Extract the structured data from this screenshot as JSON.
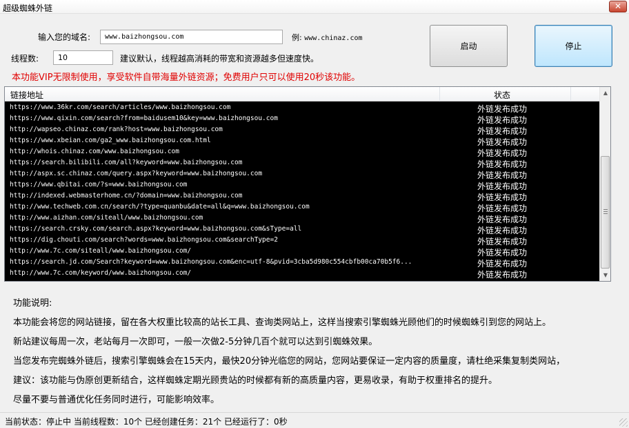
{
  "window": {
    "title": "超级蜘蛛外链",
    "close_label": "✕"
  },
  "form": {
    "domain_label": "输入您的域名:",
    "domain_value": "www.baizhongsou.com",
    "example_prefix": "例:",
    "example_value": "www.chinaz.com",
    "threads_label": "线程数:",
    "threads_value": "10",
    "threads_hint": "建议默认，线程越高消耗的带宽和资源越多但速度快。"
  },
  "buttons": {
    "start": "启动",
    "stop": "停止"
  },
  "vip_notice": "本功能VIP无限制使用，享受软件自带海量外链资源；免费用户只可以使用20秒该功能。",
  "table": {
    "columns": [
      "链接地址",
      "状态"
    ],
    "rows": [
      {
        "url": "https://www.36kr.com/search/articles/www.baizhongsou.com",
        "status": "外链发布成功"
      },
      {
        "url": "https://www.qixin.com/search?from=baidusem10&key=www.baizhongsou.com",
        "status": "外链发布成功"
      },
      {
        "url": "http://wapseo.chinaz.com/rank?host=www.baizhongsou.com",
        "status": "外链发布成功"
      },
      {
        "url": "https://www.xbeian.com/ga2_www.baizhongsou.com.html",
        "status": "外链发布成功"
      },
      {
        "url": "http://whois.chinaz.com/www.baizhongsou.com",
        "status": "外链发布成功"
      },
      {
        "url": "https://search.bilibili.com/all?keyword=www.baizhongsou.com",
        "status": "外链发布成功"
      },
      {
        "url": "http://aspx.sc.chinaz.com/query.aspx?keyword=www.baizhongsou.com",
        "status": "外链发布成功"
      },
      {
        "url": "https://www.qbitai.com/?s=www.baizhongsou.com",
        "status": "外链发布成功"
      },
      {
        "url": "http://indexed.webmasterhome.cn/?domain=www.baizhongsou.com",
        "status": "外链发布成功"
      },
      {
        "url": "http://www.techweb.com.cn/search/?type=quanbu&date=all&q=www.baizhongsou.com",
        "status": "外链发布成功"
      },
      {
        "url": "http://www.aizhan.com/siteall/www.baizhongsou.com",
        "status": "外链发布成功"
      },
      {
        "url": "https://search.crsky.com/search.aspx?keyword=www.baizhongsou.com&sType=all",
        "status": "外链发布成功"
      },
      {
        "url": "https://dig.chouti.com/search?words=www.baizhongsou.com&searchType=2",
        "status": "外链发布成功"
      },
      {
        "url": "http://www.7c.com/siteall/www.baizhongsou.com/",
        "status": "外链发布成功"
      },
      {
        "url": "https://search.jd.com/Search?keyword=www.baizhongsou.com&enc=utf-8&pvid=3cba5d980c554cbfb00ca70b5f6...",
        "status": "外链发布成功"
      },
      {
        "url": "http://www.7c.com/keyword/www.baizhongsou.com/",
        "status": "外链发布成功"
      }
    ]
  },
  "description": {
    "heading": "功能说明:",
    "lines": [
      "本功能会将您的网站链接，留在各大权重比较高的站长工具、查询类网站上，这样当搜索引擎蜘蛛光顾他们的时候蜘蛛引到您的网站上。",
      "新站建议每周一次，老站每月一次即可，一般一次做2-5分钟几百个就可以达到引蜘蛛效果。",
      "当您发布完蜘蛛外链后，搜索引擎蜘蛛会在15天内，最快20分钟光临您的网站，您网站要保证一定内容的质量度，请杜绝采集复制类网站，",
      "建议：该功能与伪原创更新结合，这样蜘蛛定期光顾贵站的时候都有新的高质量内容，更易收录，有助于权重排名的提升。",
      "尽量不要与普通优化任务同时进行，可能影响效率。"
    ]
  },
  "statusbar": {
    "text": "当前状态：停止中  当前线程数：10个  已经创建任务：21个  已经运行了：0秒"
  },
  "colors": {
    "vip_notice": "#e00000",
    "grid_bg": "#000000",
    "grid_text": "#ffffff"
  }
}
